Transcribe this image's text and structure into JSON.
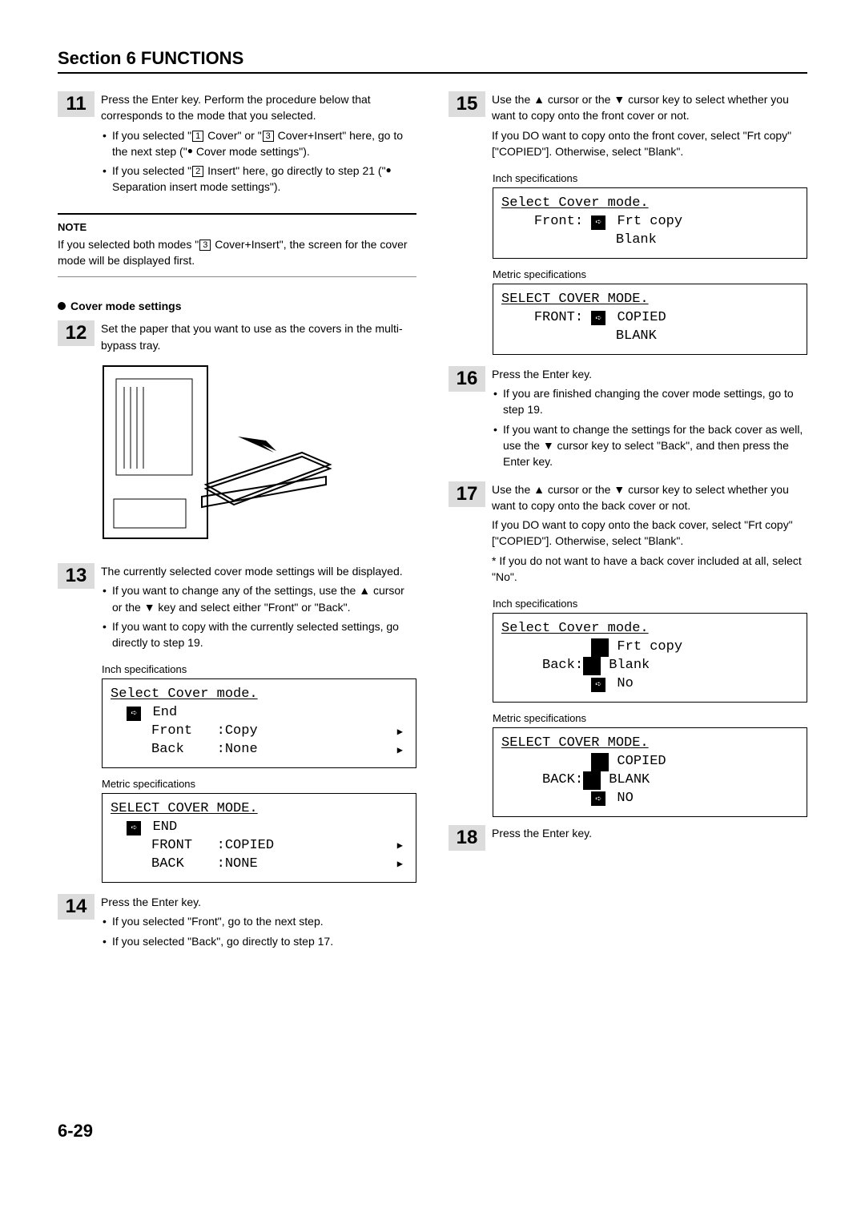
{
  "header": {
    "title": "Section 6  FUNCTIONS"
  },
  "page_number": "6-29",
  "left": {
    "step11": {
      "num": "11",
      "p1": "Press the Enter key. Perform the procedure below that corresponds to the mode that you selected.",
      "b1_pre": "If you selected \"",
      "b1_d1": "1",
      "b1_mid": " Cover\" or \"",
      "b1_d3": "3",
      "b1_post": " Cover+Insert\" here, go to the next step (\"",
      "b1_end": " Cover mode settings\").",
      "b2_pre": "If you selected \"",
      "b2_d2": "2",
      "b2_mid": " Insert\" here, go directly to step 21 (\"",
      "b2_end": " Separation insert mode settings\")."
    },
    "note": {
      "label": "NOTE",
      "text_pre": "If you selected both modes \"",
      "text_d": "3",
      "text_post": " Cover+Insert\", the screen for the cover mode will be displayed first."
    },
    "subhead": "Cover mode settings",
    "step12": {
      "num": "12",
      "p1": "Set the paper that you want to use as the covers in the multi-bypass tray."
    },
    "step13": {
      "num": "13",
      "p1": "The currently selected cover mode settings will be displayed.",
      "b1": "If you want to change any of the settings, use the ▲ cursor or the ▼ key and select either \"Front\" or \"Back\".",
      "b2": "If you want to copy with the currently selected settings, go directly to step 19.",
      "inch_label": "Inch specifications",
      "inch_lcd": {
        "title": "Select Cover mode.",
        "r1": "End",
        "r2a": "Front",
        "r2b": ":Copy",
        "r3a": "Back",
        "r3b": ":None"
      },
      "metric_label": "Metric specifications",
      "metric_lcd": {
        "title": "SELECT COVER MODE.",
        "r1": "END",
        "r2a": "FRONT",
        "r2b": ":COPIED",
        "r3a": "BACK",
        "r3b": ":NONE"
      }
    },
    "step14": {
      "num": "14",
      "p1": "Press the Enter key.",
      "b1": "If you selected \"Front\", go to the next step.",
      "b2": "If you selected \"Back\", go directly to step 17."
    }
  },
  "right": {
    "step15": {
      "num": "15",
      "p1": "Use the ▲ cursor or the ▼ cursor key to select whether you want to copy onto the front cover or not.",
      "p2": "If you DO want to copy onto the front cover, select \"Frt copy\" [\"COPIED\"]. Otherwise, select \"Blank\".",
      "inch_label": "Inch specifications",
      "inch_lcd": {
        "title": "Select Cover mode.",
        "label": "Front:",
        "o1": "Frt copy",
        "o2": "Blank"
      },
      "metric_label": "Metric specifications",
      "metric_lcd": {
        "title": "SELECT COVER MODE.",
        "label": "FRONT:",
        "o1": "COPIED",
        "o2": "BLANK"
      }
    },
    "step16": {
      "num": "16",
      "p1": "Press the Enter key.",
      "b1": "If you are finished changing the cover mode settings, go to step 19.",
      "b2": "If you want to change the settings for the back cover as well, use the ▼ cursor key to select \"Back\", and then press the Enter key."
    },
    "step17": {
      "num": "17",
      "p1": "Use the ▲ cursor or the ▼ cursor key to select whether you want to copy onto the back cover or not.",
      "p2": "If you DO want to copy onto the back cover, select \"Frt copy\" [\"COPIED\"]. Otherwise, select \"Blank\".",
      "p3": "* If you do not want to have a back cover included at all, select \"No\".",
      "inch_label": "Inch specifications",
      "inch_lcd": {
        "title": "Select Cover mode.",
        "label": "Back:",
        "o1": "Frt copy",
        "o2": "Blank",
        "o3": "No"
      },
      "metric_label": "Metric specifications",
      "metric_lcd": {
        "title": "SELECT COVER MODE.",
        "label": "BACK:",
        "o1": "COPIED",
        "o2": "BLANK",
        "o3": "NO"
      }
    },
    "step18": {
      "num": "18",
      "p1": "Press the Enter key."
    }
  }
}
